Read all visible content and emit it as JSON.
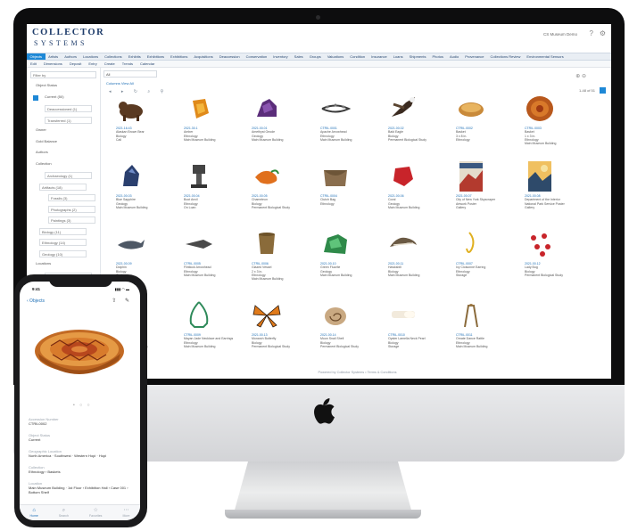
{
  "app": {
    "logo_line1": "COLLECTOR",
    "logo_line2": "SYSTEMS",
    "user_label": "CS Museum Demo"
  },
  "nav": {
    "items": [
      "Objects",
      "Artists",
      "Authors",
      "Locations",
      "Collections",
      "Exhibits",
      "Exhibitions",
      "Exhibitions",
      "Acquisitions",
      "Deaccession",
      "Conservation",
      "Inventory",
      "Sales",
      "Groups",
      "Valuations",
      "Condition",
      "Insurance",
      "Loans",
      "Shipments",
      "Photos",
      "Audio",
      "Provenance",
      "Collections Review",
      "Environmental Sensors"
    ],
    "active_index": 0
  },
  "subnav": {
    "items": [
      "Edit",
      "Dimensions",
      "Deposit",
      "Entry",
      "Create",
      "Trends",
      "Calendar"
    ]
  },
  "sidebar": {
    "filter_placeholder": "Filter by",
    "rows": [
      "Object Status",
      "Current (50)",
      "Deaccessioned (1)",
      "Transferred (1)",
      "Owner",
      "Gold Balance",
      "Authors",
      "Collection",
      "Archaeology (1)",
      "Artifacts (18)",
      "Fossils (3)",
      "Photographs (2)",
      "Paintings (3)",
      "Biology (11)",
      "Ethnology (14)",
      "Geology (10)",
      "Locations",
      "CAB (6)",
      "Conservation (3)",
      "Climate Laboratory (2)",
      "Main Museum Building (20)",
      "On Loan (2)"
    ]
  },
  "toolbar": {
    "select_value": "All",
    "link_text": "Columns  View All",
    "per_page": "1-48 of 51"
  },
  "objects": [
    {
      "caption": [
        "2021.16.43",
        "Alaskan Brown Bear",
        "Biology",
        "Cali"
      ]
    },
    {
      "caption": [
        "2021.30.1",
        "Amber",
        "Ethnology",
        "Main Museum Building"
      ]
    },
    {
      "caption": [
        "2021.00.01",
        "Amethyst Geode",
        "Geology",
        "Main Museum Building"
      ]
    },
    {
      "caption": [
        "CTRIL.0001",
        "Apache Arrowhead",
        "Ethnology",
        "Main Museum Building"
      ]
    },
    {
      "caption": [
        "2021.00.02",
        "Bald Eagle",
        "Biology",
        "Permanent Biological Study"
      ]
    },
    {
      "caption": [
        "CTRIL.0002",
        "Basket",
        "3 x 8 in.",
        "Ethnology"
      ]
    },
    {
      "caption": [
        "CTRIL.0003",
        "Basket",
        "1 x 3 in.",
        "Ethnology",
        "Main Museum Building"
      ]
    },
    {
      "caption": [
        "2021.00.03",
        "Blue Sapphire",
        "Geology",
        "Main Museum Building"
      ]
    },
    {
      "caption": [
        "2021.00.04",
        "Boot Anvil",
        "Ethnology",
        "On Loan"
      ]
    },
    {
      "caption": [
        "2021.00.05",
        "Chameleon",
        "Biology",
        "Permanent Biological Study"
      ]
    },
    {
      "caption": [
        "CTRIL.0004",
        "Clutch Bag",
        "Ethnology"
      ]
    },
    {
      "caption": [
        "2021.00.06",
        "Coral",
        "Geology",
        "Main Museum Building"
      ]
    },
    {
      "caption": [
        "2021.00.07",
        "City of New York Skyscraper",
        "Artwork Poster",
        "Gallery"
      ]
    },
    {
      "caption": [
        "2021.00.08",
        "Department of the Interior",
        "National Park Service Poster",
        "Gallery"
      ]
    },
    {
      "caption": [
        "2021.00.09",
        "Dolphin",
        "Biology",
        "On Loan"
      ]
    },
    {
      "caption": [
        "CTRIL.0005",
        "Flintlock Arrowhead",
        "Ethnology",
        "Main Museum Building"
      ]
    },
    {
      "caption": [
        "CTRIL.0006",
        "Glazed Vessel",
        "2 x 3 in.",
        "Ethnology",
        "Main Museum Building"
      ]
    },
    {
      "caption": [
        "2021.00.10",
        "Green Fluorite",
        "Geology",
        "Main Museum Building"
      ]
    },
    {
      "caption": [
        "2021.00.11",
        "Hawksbill",
        "Biology",
        "Main Museum Building"
      ]
    },
    {
      "caption": [
        "CTRIL.0007",
        "Ivy Cloisonné Earring",
        "Ethnology",
        "Storage"
      ]
    },
    {
      "caption": [
        "2021.00.12",
        "Lady Bug",
        "Biology",
        "Permanent Biological Study"
      ]
    },
    {
      "caption": [
        "CTRIL.0008",
        "Glazed Vessel",
        "Ethnology",
        "Main Museum Building"
      ]
    },
    {
      "caption": [
        "CTRIL.0009",
        "Mayan Jade Necklace and Earrings",
        "Ethnology",
        "Main Museum Building"
      ]
    },
    {
      "caption": [
        "2021.00.13",
        "Monarch Butterfly",
        "Biology",
        "Permanent Biological Study"
      ]
    },
    {
      "caption": [
        "2021.00.14",
        "Moon Snail Shell",
        "Biology",
        "Permanent Biological Study"
      ]
    },
    {
      "caption": [
        "CTRIL.0010",
        "Oyster Lamella Neck Pearl",
        "Biology",
        "Storage"
      ]
    },
    {
      "caption": [
        "CTRIL.0011",
        "Ornate Dance Rattle",
        "Ethnology",
        "Main Museum Building"
      ]
    }
  ],
  "footer": "Powered by Collector Systems • Terms & Conditions",
  "phone": {
    "time": "9:41",
    "status": "▮▮▮ ◠ ▬",
    "back": "‹  Objects",
    "actions": "⇧ ✎",
    "dots": "• ○ ○",
    "fields": [
      {
        "label": "Accession Number",
        "value": "CTRIL0002"
      },
      {
        "label": "Object Status",
        "value": "Current"
      },
      {
        "label": "Geographic Location",
        "value": "North America · Southwest · Western Hopi · Hopi"
      },
      {
        "label": "Collection",
        "value": "Ethnology › Baskets"
      },
      {
        "label": "Location",
        "value": "Main Museum Building · 1st Floor › Exhibition Hall › Case 001 › Bottom Shelf"
      }
    ],
    "tabs": [
      "Home",
      "Search",
      "Favorites",
      "More"
    ]
  }
}
